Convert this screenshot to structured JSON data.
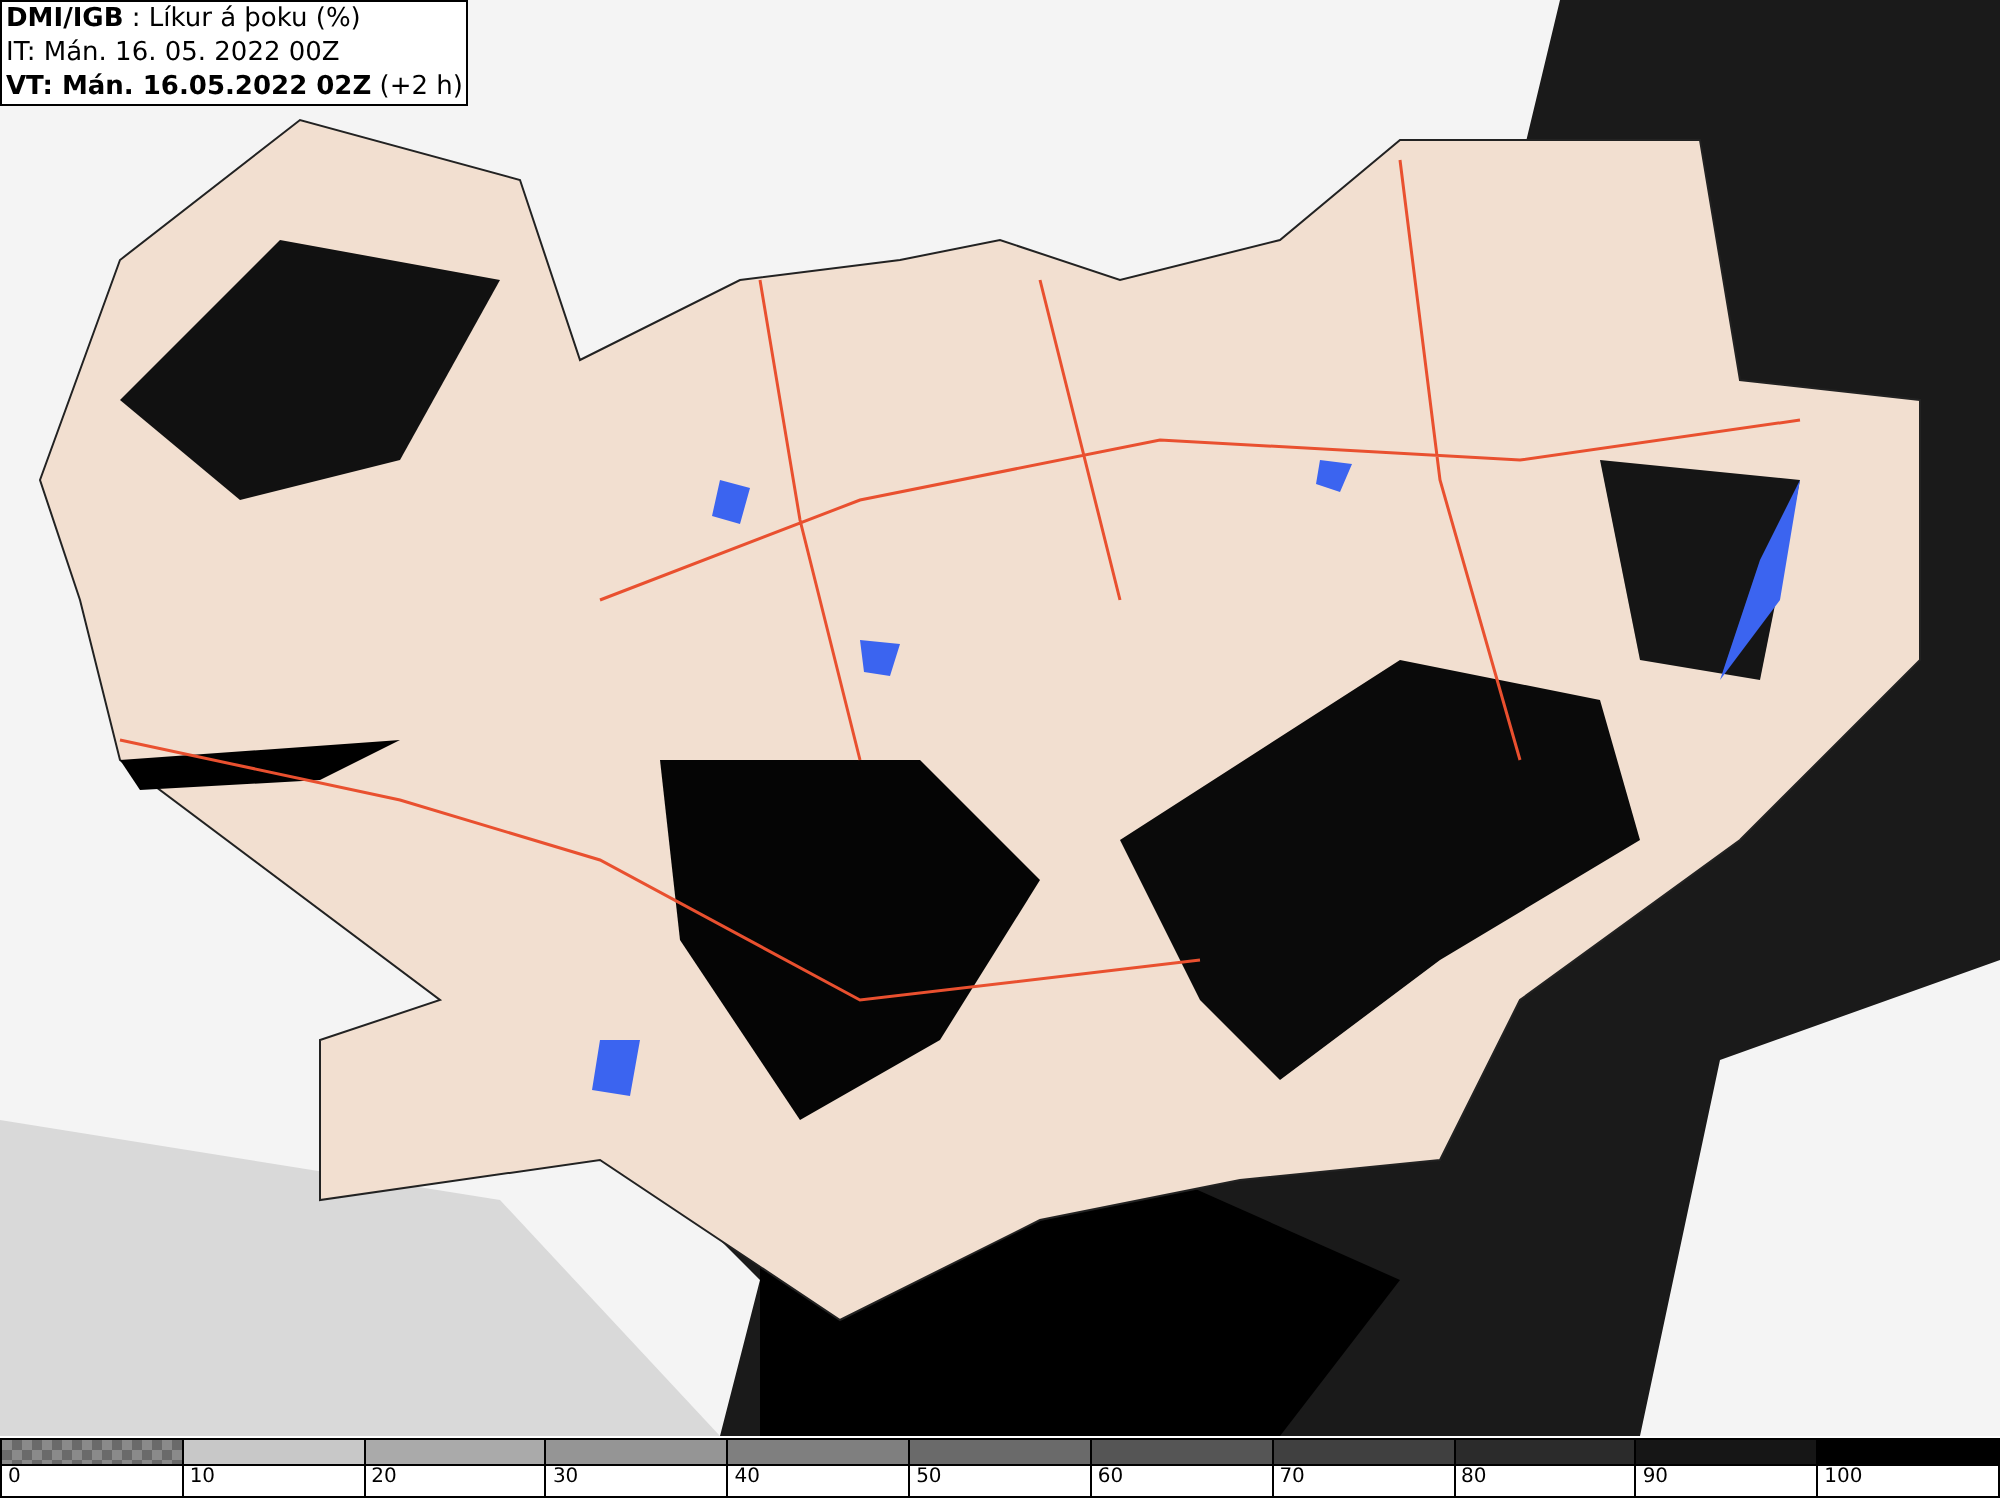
{
  "header": {
    "lines": [
      "**DMI/IGB** : Líkur á þoku (%)",
      "IT: Mán. 16. 05. 2022 00Z",
      "**VT: Mán. 16.05.2022 02Z** (+2 h)"
    ]
  },
  "legend": {
    "segments": [
      {
        "kind": "checker",
        "color": "#8a8a8a",
        "tick": "0"
      },
      {
        "kind": "solid",
        "color": "#c8c8c8",
        "tick": "10"
      },
      {
        "kind": "solid",
        "color": "#aaaaaa",
        "tick": "20"
      },
      {
        "kind": "solid",
        "color": "#959595",
        "tick": "30"
      },
      {
        "kind": "solid",
        "color": "#7f7f7f",
        "tick": "40"
      },
      {
        "kind": "solid",
        "color": "#6a6a6a",
        "tick": "50"
      },
      {
        "kind": "solid",
        "color": "#555555",
        "tick": "60"
      },
      {
        "kind": "solid",
        "color": "#404040",
        "tick": "70"
      },
      {
        "kind": "solid",
        "color": "#2b2b2b",
        "tick": "80"
      },
      {
        "kind": "solid",
        "color": "#161616",
        "tick": "90"
      },
      {
        "kind": "solid",
        "color": "#000000",
        "tick": "100"
      }
    ]
  }
}
